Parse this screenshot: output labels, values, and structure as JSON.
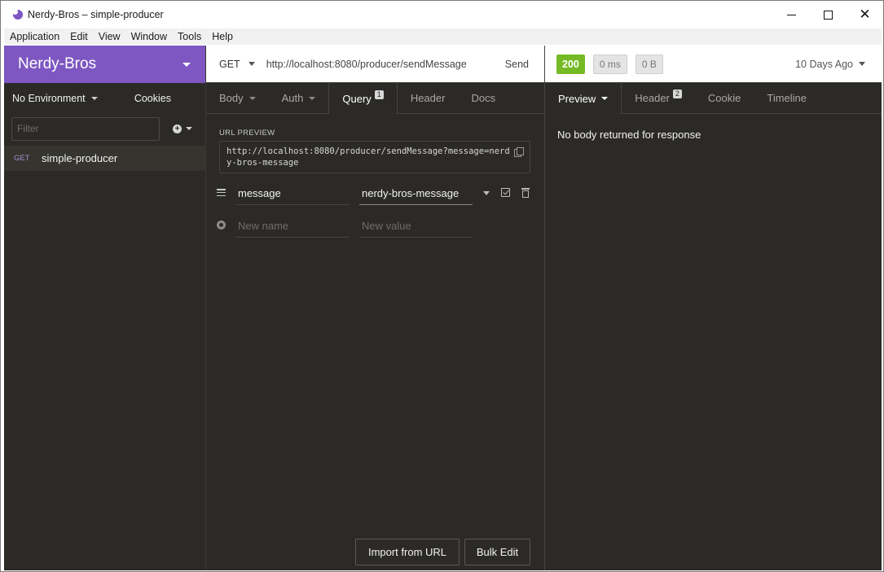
{
  "window": {
    "title": "Nerdy-Bros – simple-producer"
  },
  "menu": [
    "Application",
    "Edit",
    "View",
    "Window",
    "Tools",
    "Help"
  ],
  "sidebar": {
    "workspace": "Nerdy-Bros",
    "environment": "No Environment",
    "cookies_label": "Cookies",
    "filter_placeholder": "Filter",
    "requests": [
      {
        "method": "GET",
        "name": "simple-producer"
      }
    ]
  },
  "request": {
    "method": "GET",
    "url": "http://localhost:8080/producer/sendMessage",
    "send_label": "Send",
    "tabs": [
      {
        "label": "Body"
      },
      {
        "label": "Auth"
      },
      {
        "label": "Query",
        "badge": "1"
      },
      {
        "label": "Header"
      },
      {
        "label": "Docs"
      }
    ],
    "url_preview_label": "URL PREVIEW",
    "url_preview": "http://localhost:8080/producer/sendMessage?message=nerdy-bros-message",
    "params": [
      {
        "name": "message",
        "value": "nerdy-bros-message"
      }
    ],
    "new_name_placeholder": "New name",
    "new_value_placeholder": "New value",
    "import_label": "Import from URL",
    "bulk_edit_label": "Bulk Edit"
  },
  "response": {
    "status": "200",
    "time": "0 ms",
    "size": "0 B",
    "history": "10 Days Ago",
    "tabs": [
      {
        "label": "Preview"
      },
      {
        "label": "Header",
        "badge": "2"
      },
      {
        "label": "Cookie"
      },
      {
        "label": "Timeline"
      }
    ],
    "empty_message": "No body returned for response"
  },
  "colors": {
    "workspace_purple": "#7e57c2",
    "status_green": "#75ba24",
    "panel_bg": "#2b2a27"
  }
}
